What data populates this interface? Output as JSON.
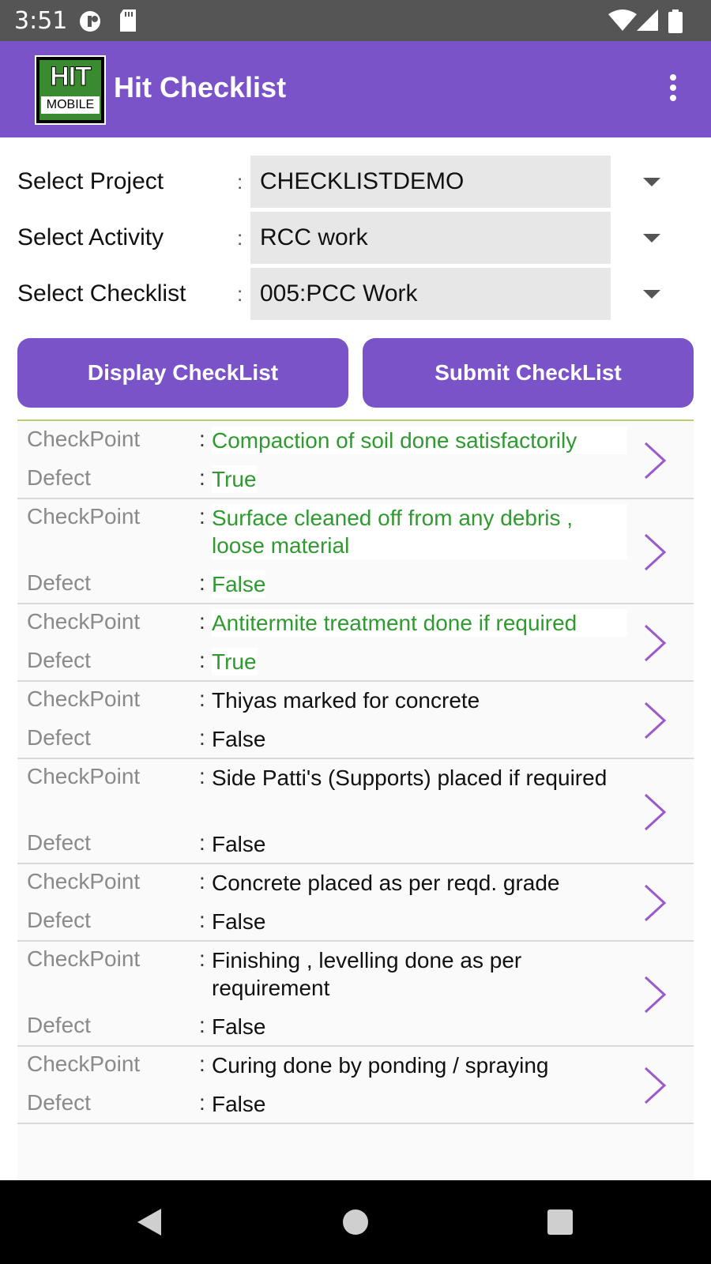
{
  "status_bar": {
    "time": "3:51"
  },
  "app_bar": {
    "title": "Hit Checklist",
    "logo_top": "HIT",
    "logo_bottom": "MOBILE"
  },
  "form": {
    "project": {
      "label": "Select Project",
      "value": "CHECKLISTDEMO"
    },
    "activity": {
      "label": "Select Activity",
      "value": "RCC work"
    },
    "checklist": {
      "label": "Select Checklist",
      "value": "005:PCC Work"
    },
    "colon": ":"
  },
  "buttons": {
    "display": "Display CheckList",
    "submit": "Submit CheckList"
  },
  "list": {
    "checkpoint_label": "CheckPoint",
    "defect_label": "Defect",
    "items": [
      {
        "checkpoint": "Compaction of soil done satisfactorily",
        "defect": "True",
        "highlighted": true
      },
      {
        "checkpoint": "Surface cleaned off from any debris , loose material",
        "defect": "False",
        "highlighted": true
      },
      {
        "checkpoint": "Antitermite treatment done if required",
        "defect": "True",
        "highlighted": true
      },
      {
        "checkpoint": "Thiyas marked for concrete",
        "defect": "False",
        "highlighted": false
      },
      {
        "checkpoint": "Side Patti's (Supports) placed if required",
        "defect": "False",
        "highlighted": false
      },
      {
        "checkpoint": "Concrete placed as per reqd. grade",
        "defect": "False",
        "highlighted": false
      },
      {
        "checkpoint": "Finishing , levelling done as per requirement",
        "defect": "False",
        "highlighted": false
      },
      {
        "checkpoint": "Curing done by ponding / spraying",
        "defect": "False",
        "highlighted": false
      }
    ]
  },
  "colors": {
    "primary": "#7b53c9",
    "highlight_text": "#2f9a2f",
    "chevron": "#9b59c9"
  },
  "icons": [
    "vpn-key-icon",
    "sd-card-icon",
    "wifi-icon",
    "signal-icon",
    "battery-icon",
    "overflow-menu-icon",
    "chevron-right-icon",
    "nav-back-icon",
    "nav-home-icon",
    "nav-recents-icon"
  ]
}
